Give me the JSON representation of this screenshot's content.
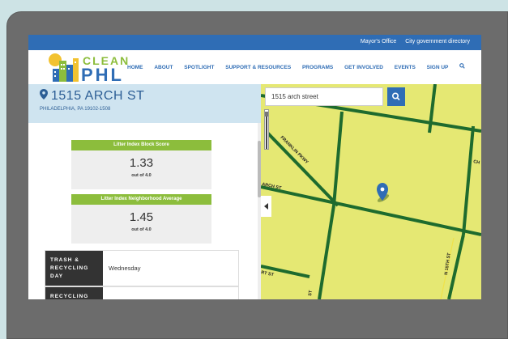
{
  "top_bar": {
    "links": [
      "Mayor's Office",
      "City government directory"
    ]
  },
  "logo": {
    "word1": "CLEAN",
    "word2": "PHL"
  },
  "menu": {
    "items": [
      "HOME",
      "ABOUT",
      "SPOTLIGHT",
      "SUPPORT & RESOURCES",
      "PROGRAMS",
      "GET INVOLVED",
      "EVENTS",
      "SIGN UP"
    ],
    "search_icon": "search-icon"
  },
  "address": {
    "title": "1515 ARCH ST",
    "subtitle": "PHILADELPHIA, PA 19102-1508"
  },
  "scores": [
    {
      "label": "Litter Index Block Score",
      "value": "1.33",
      "out_of": "out of 4.0"
    },
    {
      "label": "Litter Index Neighborhood Average",
      "value": "1.45",
      "out_of": "out of 4.0"
    }
  ],
  "schedule": [
    {
      "label": "TRASH & RECYCLING DAY",
      "value": "Wednesday"
    },
    {
      "label": "RECYCLING",
      "value": ""
    }
  ],
  "map": {
    "search_value": "1515 arch street",
    "street_labels": [
      "FRANKLIN PKWY",
      "ARCH ST",
      "RT ST",
      "N 15TH ST",
      "CH",
      "ST"
    ]
  },
  "colors": {
    "brand_blue": "#2f6db5",
    "brand_green": "#8cbd3c",
    "map_fill": "#e8e97a",
    "road_green": "#1e6b2e",
    "pin_blue": "#2f6db5"
  }
}
